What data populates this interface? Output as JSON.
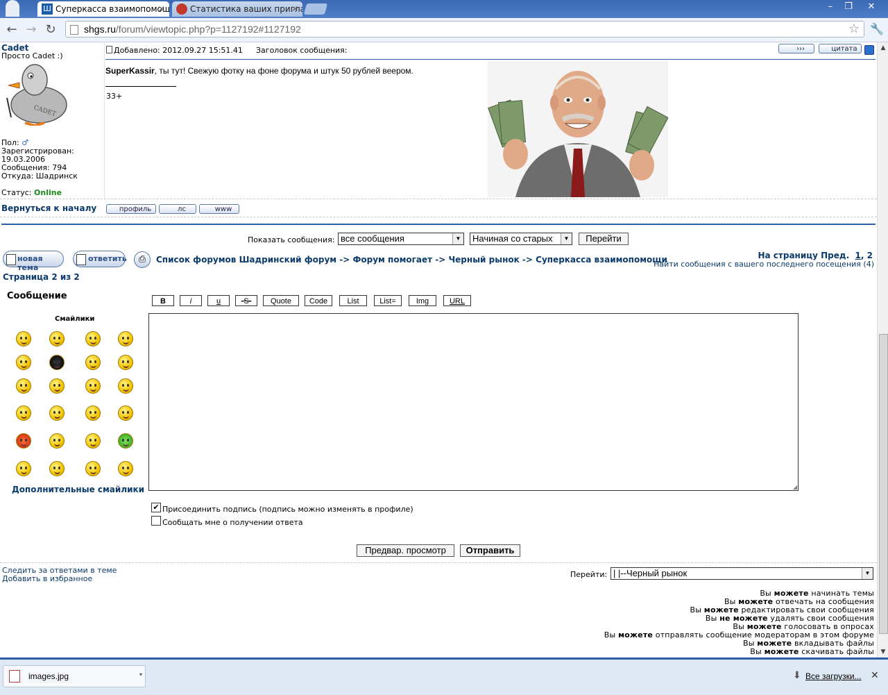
{
  "browser": {
    "tabs": [
      {
        "title": "Суперкасса взаимопомощи :",
        "active": true
      },
      {
        "title": "Статистика ваших приглаш",
        "active": false
      }
    ],
    "url_domain": "shgs.ru",
    "url_path": "/forum/viewtopic.php?p=1127192#1127192"
  },
  "post": {
    "author_name": "Cadet",
    "author_rank": "Просто Cadet :)",
    "avatar_text": "CADET",
    "gender_label": "Пол:",
    "registered_label": "Зарегистрирован:",
    "registered_date": "19.03.2006",
    "messages": "Сообщения: 794",
    "from": "Откуда: Шадринск",
    "status_label": "Статус:",
    "status_value": "Online",
    "added": "Добавлено: 2012.09.27 15:51.41",
    "subject_label": "Заголовок сообщения:",
    "quote_button": "цитата",
    "mention": "SuperKassir",
    "text": ", ты тут! Свежую фотку на фоне форума и штук 50 рублей веером.",
    "signature": "33+",
    "back_to_top": "Вернуться к началу",
    "buttons": [
      "профиль",
      "лс",
      "www"
    ]
  },
  "controls": {
    "show_messages_label": "Показать сообщения:",
    "show_messages_value": "все сообщения",
    "order_value": "Начиная со старых",
    "go_button": "Перейти"
  },
  "nav": {
    "new_topic": "новая тема",
    "reply": "ответить",
    "breadcrumb": "Список форумов Шадринский форум -> Форум помогает -> Черный рынок -> Суперкасса взаимопомощи",
    "pages_label": "На страницу Пред.",
    "page1": "1",
    "page2": "2",
    "new_since": "Найти сообщения с вашего последнего посещения (4)",
    "page_of": "Страница 2 из 2"
  },
  "editor": {
    "message_label": "Сообщение",
    "smilies_label": "Смайлики",
    "more_smilies": "Дополнительные смайлики",
    "format_buttons": [
      "B",
      "i",
      "u",
      "-S-",
      "Quote",
      "Code",
      "List",
      "List=",
      "Img",
      "URL"
    ],
    "attach_sig": "Присоединить подпись (подпись можно изменять в профиле)",
    "attach_sig_checked": true,
    "notify": "Сообщать мне о получении ответа",
    "notify_checked": false,
    "preview_button": "Предвар. просмотр",
    "submit_button": "Отправить"
  },
  "footer": {
    "watch_topic": "Следить за ответами в теме",
    "add_favorites": "Добавить в избранное",
    "jump_label": "Перейти:",
    "jump_value": "|   |--Черный рынок",
    "permissions": [
      [
        "Вы ",
        "можете",
        " начинать темы"
      ],
      [
        "Вы ",
        "можете",
        " отвечать на сообщения"
      ],
      [
        "Вы ",
        "можете",
        " редактировать свои сообщения"
      ],
      [
        "Вы ",
        "не можете",
        " удалять свои сообщения"
      ],
      [
        "Вы ",
        "можете",
        " голосовать в опросах"
      ],
      [
        "Вы ",
        "можете",
        " отправлять сообщение модераторам в этом форуме"
      ],
      [
        "Вы ",
        "можете",
        " вкладывать файлы"
      ],
      [
        "Вы ",
        "можете",
        " скачивать файлы"
      ]
    ]
  },
  "downloads": {
    "file": "images.jpg",
    "all_downloads": "Все загрузки..."
  }
}
